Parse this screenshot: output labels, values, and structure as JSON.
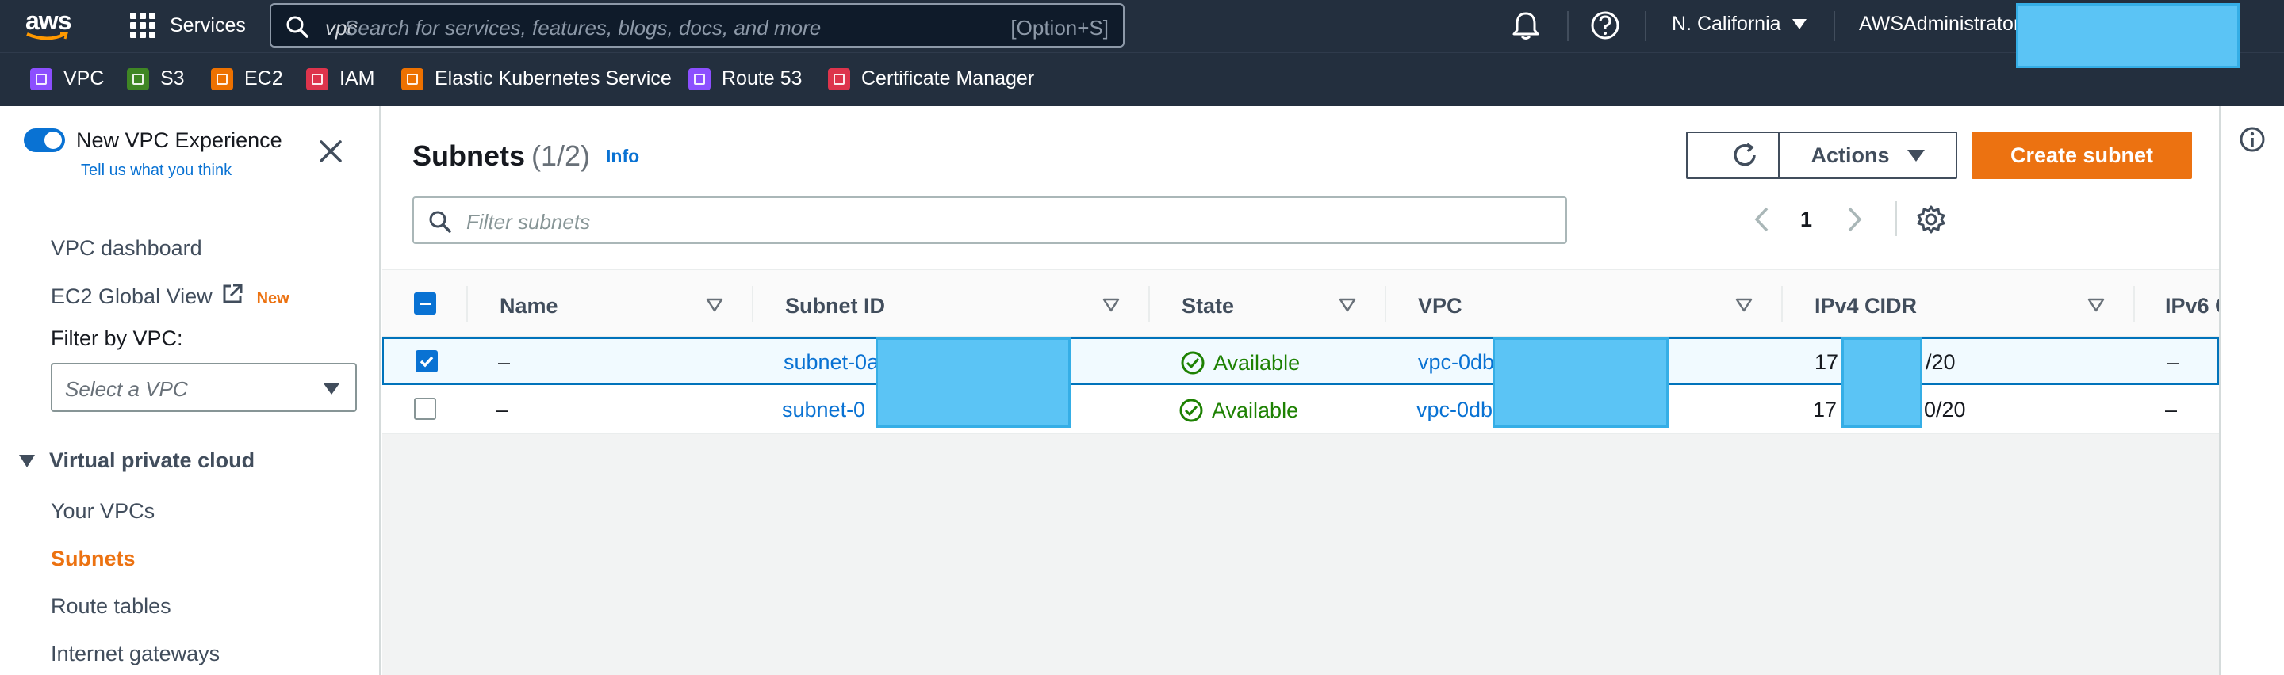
{
  "topnav": {
    "logo": "aws",
    "services_label": "Services",
    "search_value": "vpc",
    "search_placeholder": "Search for services, features, blogs, docs, and more",
    "search_shortcut": "[Option+S]",
    "region": "N. California",
    "account": "AWSAdministrator"
  },
  "favorites": [
    {
      "label": "VPC",
      "color": "#8c4fff"
    },
    {
      "label": "S3",
      "color": "#3f8624"
    },
    {
      "label": "EC2",
      "color": "#ed7100"
    },
    {
      "label": "IAM",
      "color": "#dd344c"
    },
    {
      "label": "Elastic Kubernetes Service",
      "color": "#ed7100"
    },
    {
      "label": "Route 53",
      "color": "#8c4fff"
    },
    {
      "label": "Certificate Manager",
      "color": "#dd344c"
    }
  ],
  "leftpanel": {
    "new_experience_label": "New VPC Experience",
    "feedback_link": "Tell us what you think",
    "vpc_dashboard": "VPC dashboard",
    "ec2_global_view": "EC2 Global View",
    "new_badge": "New",
    "filter_label": "Filter by VPC:",
    "select_placeholder": "Select a VPC",
    "section_title": "Virtual private cloud",
    "items": [
      "Your VPCs",
      "Subnets",
      "Route tables",
      "Internet gateways"
    ]
  },
  "main": {
    "title": "Subnets",
    "count": "(1/2)",
    "info": "Info",
    "actions_label": "Actions",
    "create_label": "Create subnet",
    "filter_placeholder": "Filter subnets",
    "page_number": "1",
    "columns": [
      "Name",
      "Subnet ID",
      "State",
      "VPC",
      "IPv4 CIDR",
      "IPv6 C"
    ],
    "rows": [
      {
        "selected": true,
        "name": "–",
        "subnet_id": "subnet-0a",
        "state": "Available",
        "vpc": "vpc-0db",
        "cidr_start": "17",
        "cidr_end": "/20",
        "ipv6": "–"
      },
      {
        "selected": false,
        "name": "–",
        "subnet_id": "subnet-0",
        "state": "Available",
        "vpc": "vpc-0db",
        "cidr_start": "17",
        "cidr_end": "0/20",
        "ipv6": "–"
      }
    ]
  },
  "colors": {
    "nav_bg": "#232f3e",
    "accent_orange": "#ec7211",
    "link_blue": "#0972d3",
    "status_green": "#1d8102",
    "redaction": "#5bc4f5"
  }
}
